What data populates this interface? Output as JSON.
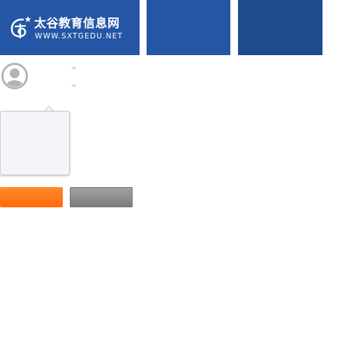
{
  "header": {
    "logo": {
      "icon": "swirl-logo-icon",
      "title": "太谷教育信息网",
      "url_text": "WWW.SXTGEDU.NET"
    }
  },
  "profile": {
    "avatar_icon": "user-avatar-icon",
    "stepper": {
      "up_icon": "chevron-up-icon",
      "down_icon": "chevron-down-icon"
    }
  },
  "popover": {
    "content": ""
  },
  "actions": {
    "primary_label": "",
    "secondary_label": ""
  },
  "colors": {
    "brand_blue": "#2556a6",
    "brand_blue_dark": "#1e4b8e",
    "accent_orange": "#ff7a1a",
    "button_gray": "#8f8f8f",
    "avatar_gray": "#b3b3b3",
    "popover_bg": "#f4f5f9"
  }
}
